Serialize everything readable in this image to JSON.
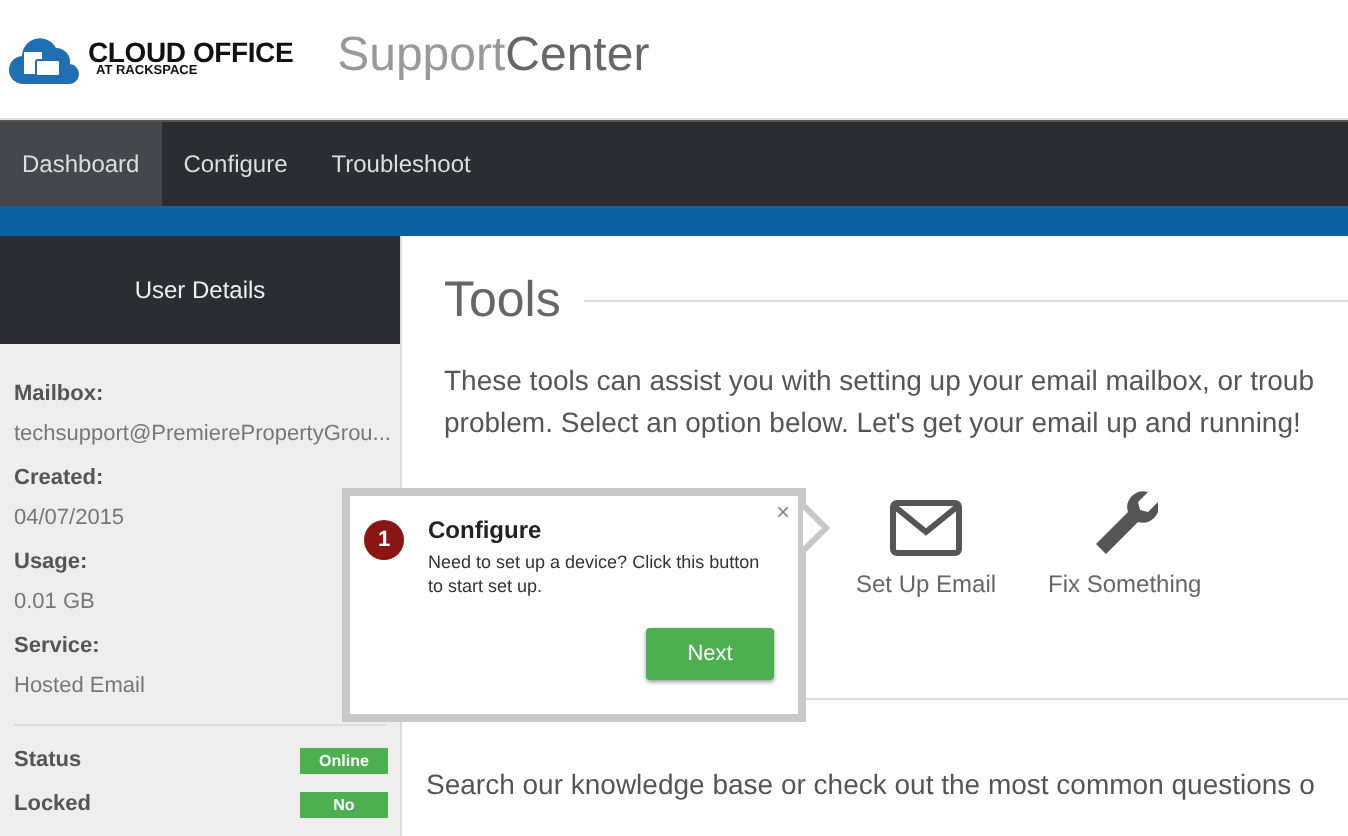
{
  "header": {
    "logo": {
      "name": "CLOUD OFFICE",
      "sub": "AT RACKSPACE"
    },
    "title": "Support**Center**"
  },
  "nav": [
    {
      "label": "Dashboard",
      "selected": true
    },
    {
      "label": "Configure",
      "selected": false
    },
    {
      "label": "Troubleshoot",
      "selected": false
    }
  ],
  "sidebar": {
    "title": "User Details",
    "details": [
      {
        "label": "Mailbox:",
        "value": "techsupport@PremierePropertyGrou..."
      },
      {
        "label": "Created:",
        "value": "04/07/2015"
      },
      {
        "label": "Usage:",
        "value": "0.01 GB"
      },
      {
        "label": "Service:",
        "value": "Hosted Email"
      }
    ],
    "statuses": [
      {
        "label": "Status",
        "badge": "Online"
      },
      {
        "label": "Locked",
        "badge": "No"
      }
    ]
  },
  "tools": {
    "heading": "Tools",
    "intro": "These tools can assist you with setting up your email mailbox, or troub\nproblem. Select an option below. Let's get your email up and running!",
    "items": [
      {
        "kind": "email",
        "label": "Set Up Email"
      },
      {
        "kind": "wrench",
        "label": "Fix Something"
      }
    ]
  },
  "resources": {
    "intro": "Search our knowledge base or check out the most common questions o"
  },
  "popover": {
    "step": "1",
    "title": "Configure",
    "text": "Need to set up a device? Click this button to start set up.",
    "close": "×",
    "button": "Next"
  }
}
